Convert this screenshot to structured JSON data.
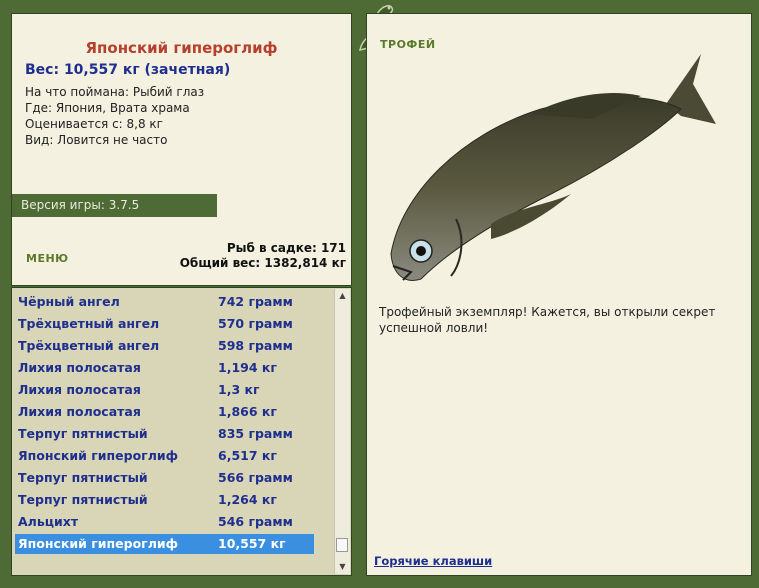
{
  "fish": {
    "title": "Японский гипероглиф",
    "weight_line": "Вес: 10,557 кг (зачетная)",
    "caught_on": "На что поймана: Рыбий глаз",
    "location": "Где: Япония, Врата храма",
    "valued_from": "Оценивается с: 8,8 кг",
    "type": "Вид: Ловится не часто"
  },
  "version": "Версия игры: 3.7.5",
  "menu_label": "МЕНЮ",
  "cage": {
    "count_line": "Рыб в садке: 171",
    "total_line": "Общий вес: 1382,814 кг"
  },
  "catch_list": [
    {
      "name": "Чёрный ангел",
      "weight": "742 грамм"
    },
    {
      "name": "Трёхцветный ангел",
      "weight": "570 грамм"
    },
    {
      "name": "Трёхцветный ангел",
      "weight": "598 грамм"
    },
    {
      "name": "Лихия полосатая",
      "weight": "1,194 кг"
    },
    {
      "name": "Лихия полосатая",
      "weight": "1,3 кг"
    },
    {
      "name": "Лихия полосатая",
      "weight": "1,866 кг"
    },
    {
      "name": "Терпуг пятнистый",
      "weight": "835 грамм"
    },
    {
      "name": "Японский гипероглиф",
      "weight": "6,517 кг"
    },
    {
      "name": "Терпуг пятнистый",
      "weight": "566 грамм"
    },
    {
      "name": "Терпуг пятнистый",
      "weight": "1,264 кг"
    },
    {
      "name": "Альцихт",
      "weight": "546 грамм"
    },
    {
      "name": "Японский гипероглиф",
      "weight": "10,557 кг"
    }
  ],
  "selected_index": 11,
  "trophy": {
    "label": "ТРОФЕЙ",
    "text": "Трофейный экземпляр! Кажется, вы открыли секрет успешной ловли!"
  },
  "hotkeys_label": "Горячие клавиши",
  "icons": [
    "lizard-logo-icon",
    "fish-image",
    "scroll-up-icon",
    "scroll-down-icon"
  ]
}
